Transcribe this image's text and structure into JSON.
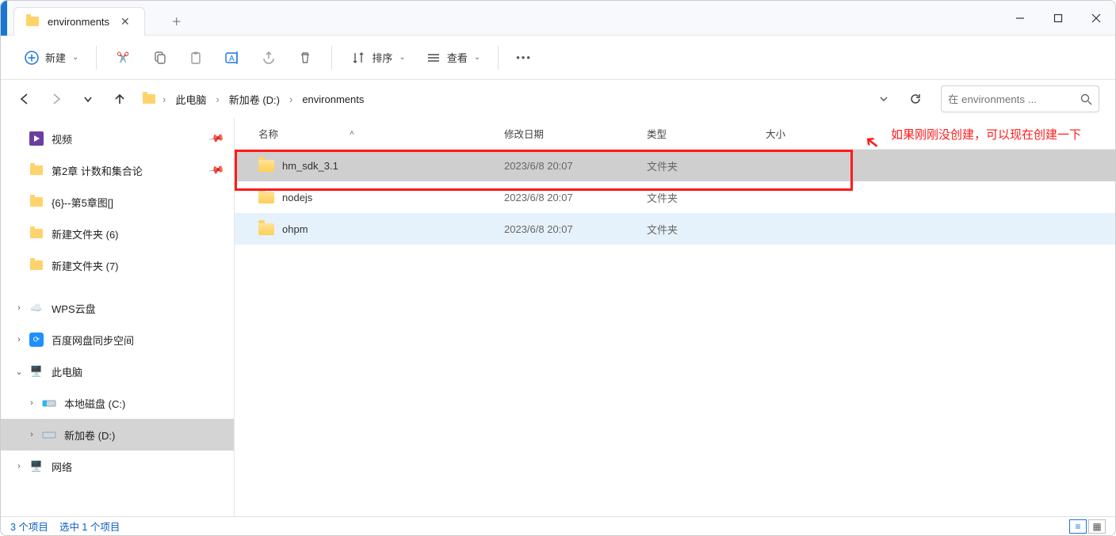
{
  "window": {
    "title": "environments"
  },
  "toolbar": {
    "new_label": "新建",
    "sort_label": "排序",
    "view_label": "查看"
  },
  "breadcrumb": {
    "items": [
      "此电脑",
      "新加卷 (D:)",
      "environments"
    ]
  },
  "search": {
    "placeholder": "在 environments ..."
  },
  "columns": {
    "name": "名称",
    "date": "修改日期",
    "type": "类型",
    "size": "大小"
  },
  "sidebar": {
    "quick": [
      {
        "label": "视频",
        "icon": "video",
        "pinned": true
      },
      {
        "label": "第2章 计数和集合论",
        "icon": "folder",
        "pinned": true
      },
      {
        "label": "{6}--第5章图[]",
        "icon": "folder",
        "pinned": false
      },
      {
        "label": "新建文件夹 (6)",
        "icon": "folder",
        "pinned": false
      },
      {
        "label": "新建文件夹 (7)",
        "icon": "folder",
        "pinned": false
      }
    ],
    "cloud": [
      {
        "label": "WPS云盘",
        "icon": "wps"
      },
      {
        "label": "百度网盘同步空间",
        "icon": "baidu"
      }
    ],
    "thispc_label": "此电脑",
    "drives": [
      {
        "label": "本地磁盘 (C:)",
        "selected": false
      },
      {
        "label": "新加卷 (D:)",
        "selected": true
      }
    ],
    "network_label": "网络"
  },
  "files": [
    {
      "name": "hm_sdk_3.1",
      "date": "2023/6/8 20:07",
      "type": "文件夹",
      "size": "",
      "state": "selected"
    },
    {
      "name": "nodejs",
      "date": "2023/6/8 20:07",
      "type": "文件夹",
      "size": "",
      "state": ""
    },
    {
      "name": "ohpm",
      "date": "2023/6/8 20:07",
      "type": "文件夹",
      "size": "",
      "state": "hover"
    }
  ],
  "annotation": {
    "text": "如果刚刚没创建，可以现在创建一下"
  },
  "statusbar": {
    "count": "3 个项目",
    "selected": "选中 1 个项目"
  }
}
